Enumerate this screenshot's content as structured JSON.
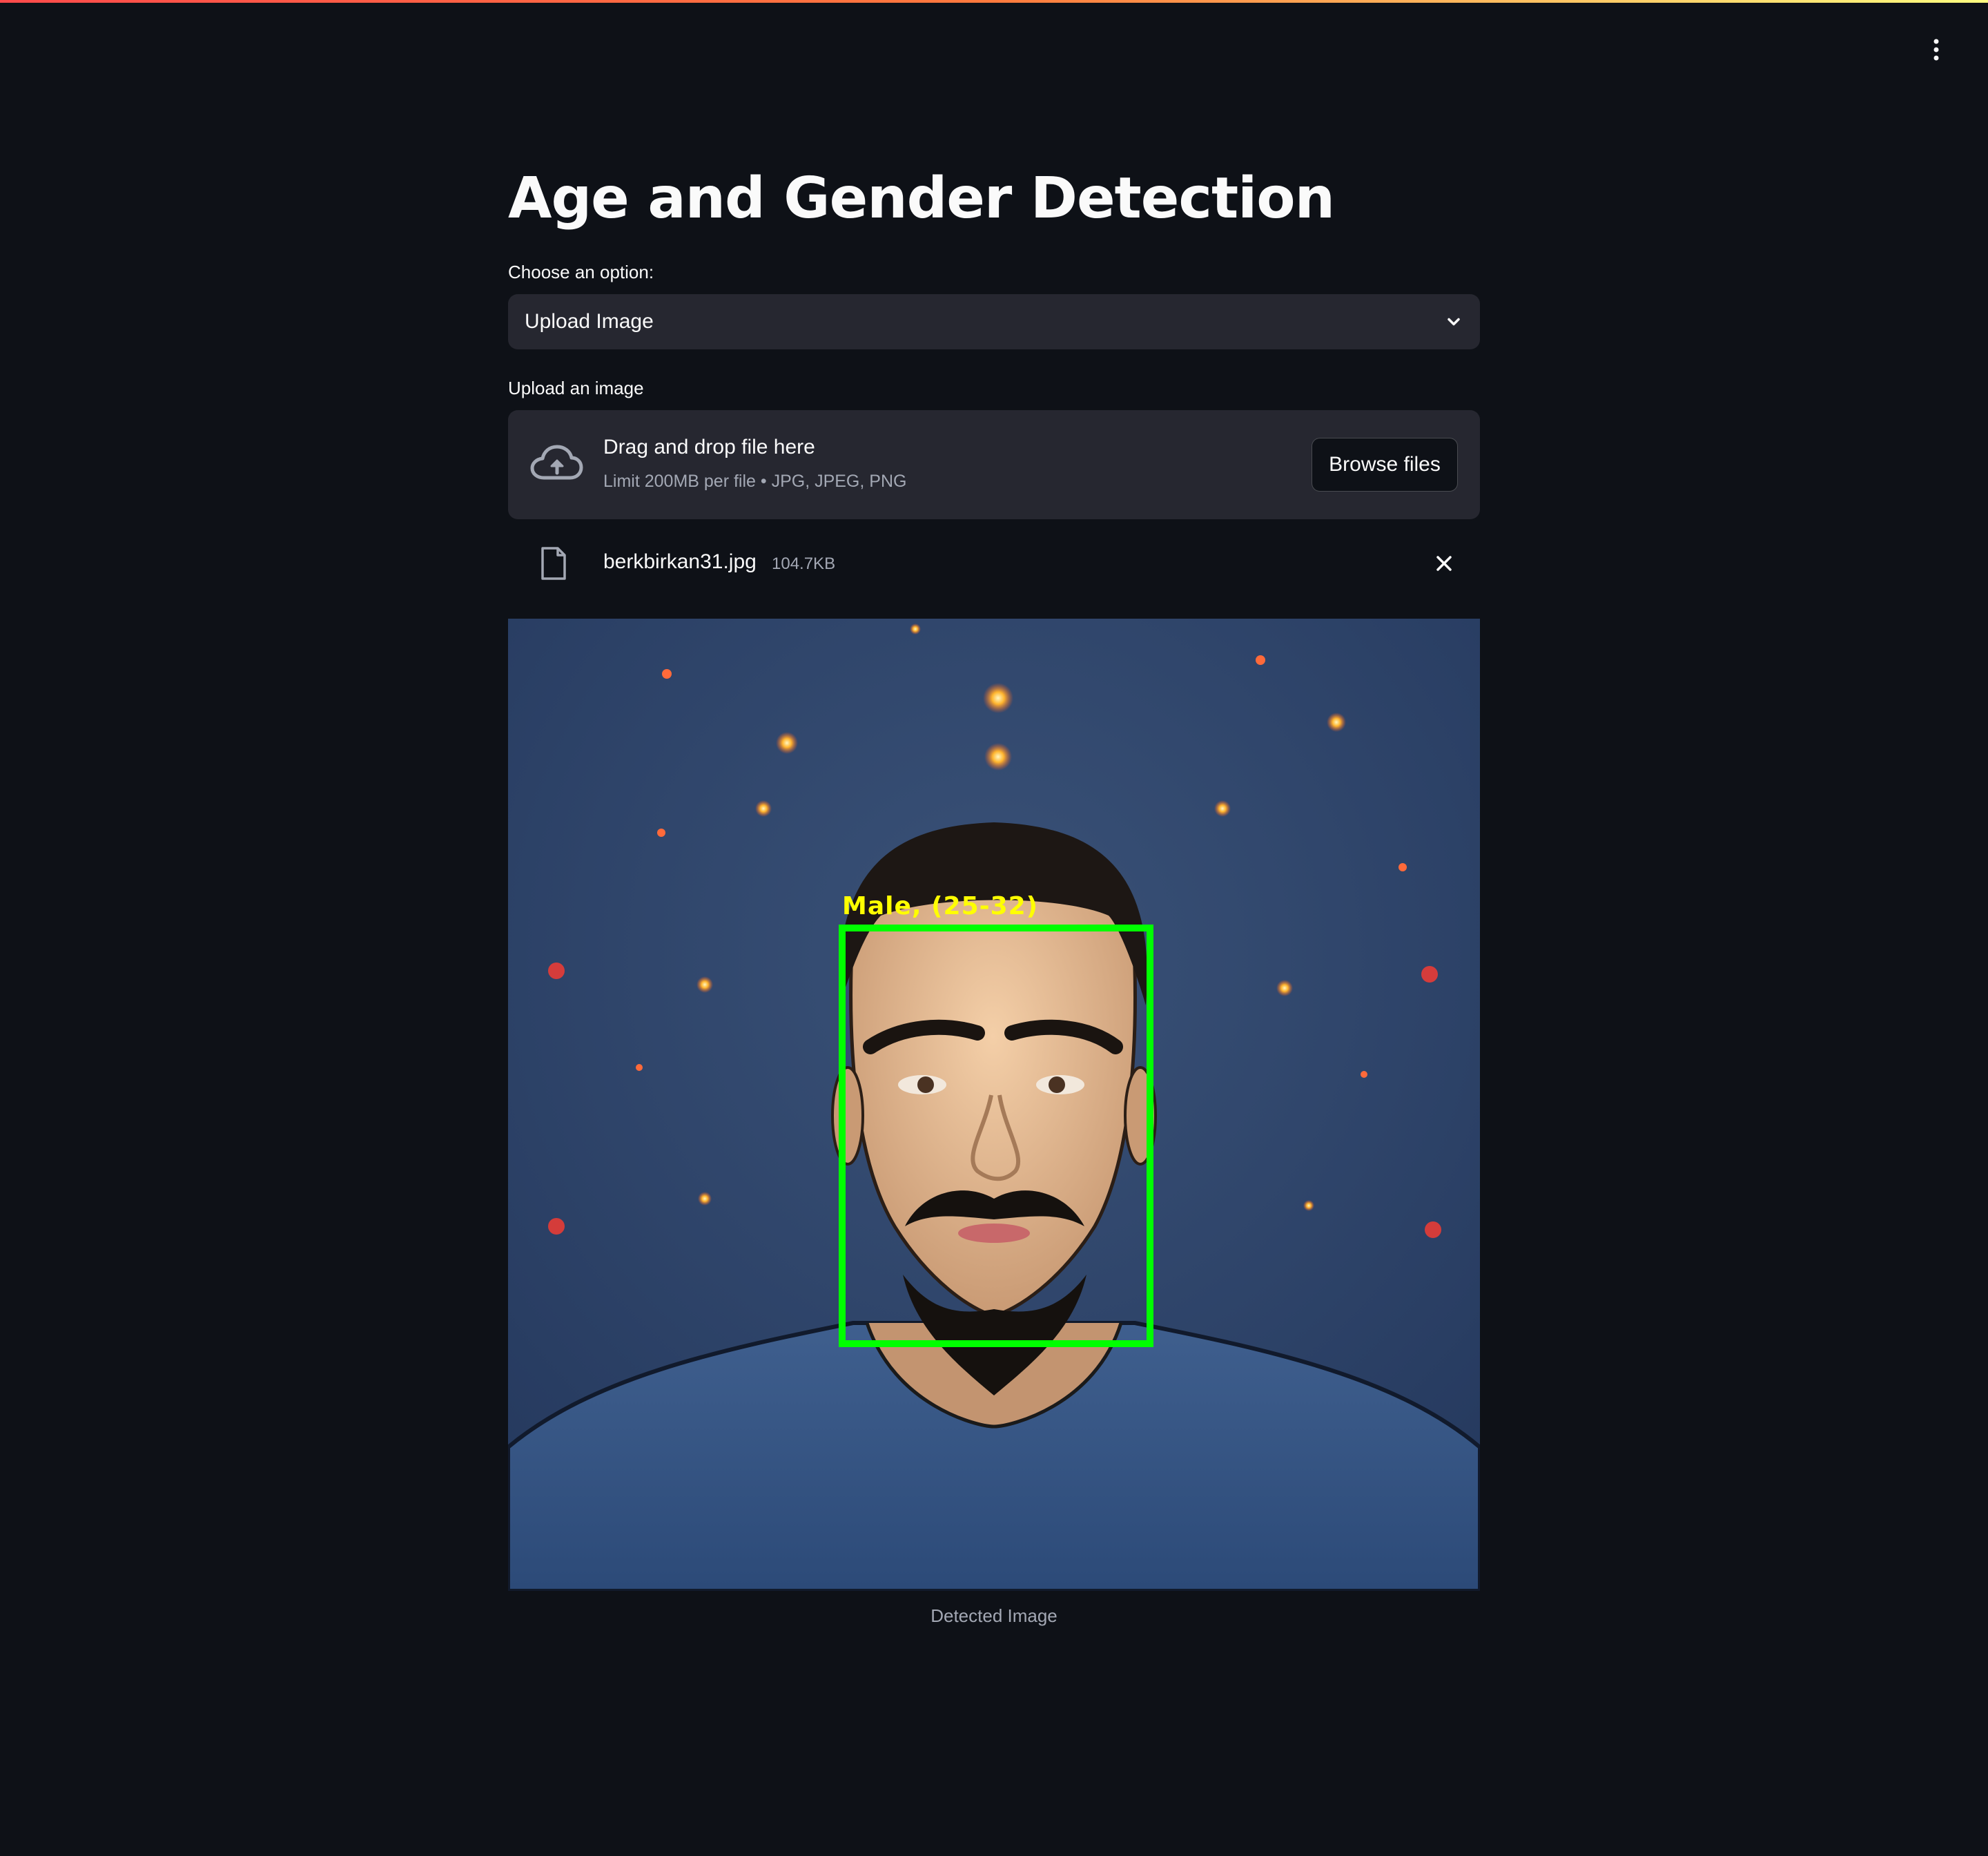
{
  "app": {
    "title": "Age and Gender Detection",
    "menu_icon": "kebab-menu-icon"
  },
  "option_select": {
    "label": "Choose an option:",
    "value": "Upload Image",
    "icon": "chevron-down-icon"
  },
  "uploader": {
    "label": "Upload an image",
    "title": "Drag and drop file here",
    "subtitle": "Limit 200MB per file • JPG, JPEG, PNG",
    "browse_label": "Browse files",
    "icon": "cloud-upload-icon"
  },
  "uploaded_file": {
    "name": "berkbirkan31.jpg",
    "size": "104.7KB",
    "icon": "file-icon",
    "remove_icon": "close-icon"
  },
  "result": {
    "detection_label": "Male, (25-32)",
    "caption": "Detected Image",
    "box_color": "#00ff00",
    "label_color": "#ffff00"
  },
  "colors": {
    "background": "#0e1117",
    "widget": "#262730",
    "text": "#fafafa",
    "muted": "#a3a8b4"
  }
}
